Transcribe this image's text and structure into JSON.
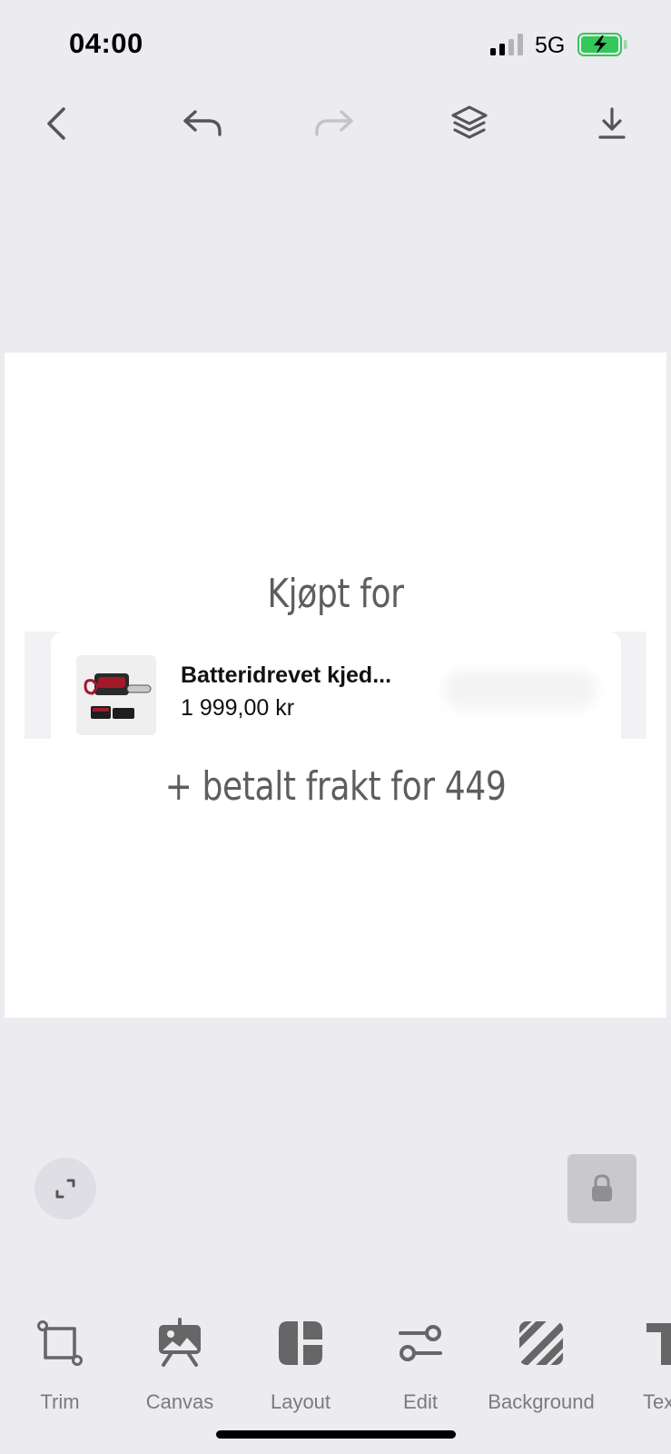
{
  "status_bar": {
    "time": "04:00",
    "network": "5G",
    "battery_color": "#34c759"
  },
  "toolbar": {
    "back_icon": "chevron-left-icon",
    "undo_icon": "undo-icon",
    "redo_icon": "redo-icon",
    "layers_icon": "layers-icon",
    "download_icon": "download-icon"
  },
  "canvas": {
    "caption_top": "Kjøpt for",
    "caption_bottom": "+ betalt frakt for 449",
    "product": {
      "title": "Batteridrevet kjed...",
      "price": "1 999,00 kr",
      "image": "chainsaw-product-image"
    }
  },
  "controls": {
    "fit_icon": "expand-icon",
    "lock_icon": "lock-icon"
  },
  "bottom_tools": [
    {
      "label": "Trim",
      "icon": "crop-icon"
    },
    {
      "label": "Canvas",
      "icon": "canvas-icon"
    },
    {
      "label": "Layout",
      "icon": "layout-icon"
    },
    {
      "label": "Edit",
      "icon": "sliders-icon"
    },
    {
      "label": "Background",
      "icon": "background-stripes-icon"
    },
    {
      "label": "Text",
      "icon": "text-icon"
    }
  ]
}
